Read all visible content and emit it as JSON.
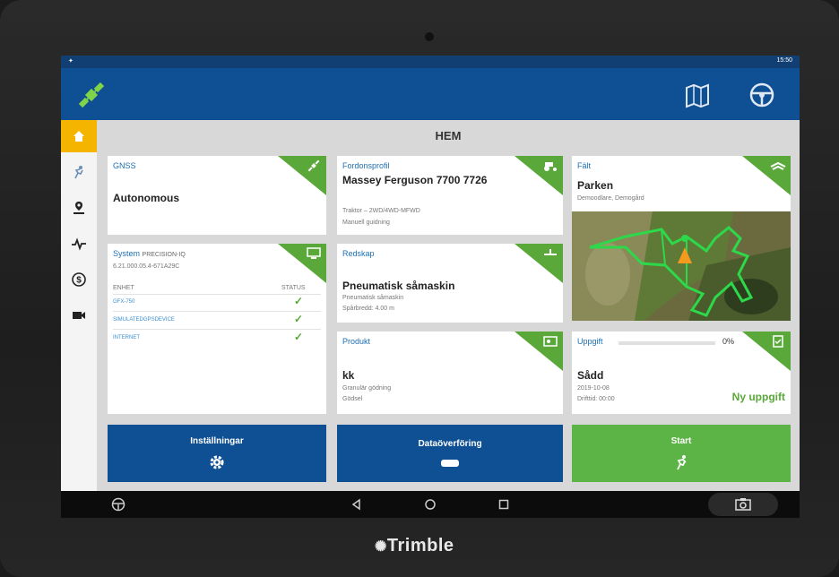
{
  "colors": {
    "appbar": "#0f4f93",
    "accent_green": "#5aa83a",
    "active_yellow": "#f5b400",
    "button_blue": "#0f4f93"
  },
  "statusbar": {
    "time": "15:50"
  },
  "page_title": "HEM",
  "sidebar": {
    "items": [
      {
        "icon": "home-icon",
        "active": true
      },
      {
        "icon": "satellite-runner-icon",
        "active": false
      },
      {
        "icon": "location-pin-icon",
        "active": false
      },
      {
        "icon": "pulse-icon",
        "active": false
      },
      {
        "icon": "dollar-circle-icon",
        "active": false
      },
      {
        "icon": "video-camera-icon",
        "active": false
      }
    ]
  },
  "gnss": {
    "title": "GNSS",
    "value": "Autonomous"
  },
  "fordon": {
    "title": "Fordonsprofil",
    "name": "Massey Ferguson 7700 7726",
    "sub1": "Traktor – 2WD/4WD-MFWD",
    "sub2": "Manuell guidning"
  },
  "falt": {
    "title": "Fält",
    "name": "Parken",
    "sub": "Demoodlare, Demogård"
  },
  "system": {
    "title": "System",
    "product": "PRECISION-IQ",
    "version": "6.21.000.05.4-671A29C",
    "col_unit": "ENHET",
    "col_status": "STATUS",
    "rows": [
      "GFX-750",
      "SIMULATEDGPSDEVICE",
      "INTERNET"
    ]
  },
  "redskap": {
    "title": "Redskap",
    "name": "Pneumatisk såmaskin",
    "sub1": "Pneumatisk såmaskin",
    "sub2": "Spårbredd: 4.00 m"
  },
  "produkt": {
    "title": "Produkt",
    "name": "kk",
    "sub1": "Granulär gödning",
    "sub2": "Gödsel"
  },
  "uppgift": {
    "title": "Uppgift",
    "progress": "0%",
    "name": "Sådd",
    "date": "2019-10-08",
    "drifttid": "Drifttid: 00:00",
    "new_task": "Ny uppgift"
  },
  "buttons": {
    "settings": "Inställningar",
    "data": "Dataöverföring",
    "start": "Start"
  },
  "brand": "Trimble"
}
